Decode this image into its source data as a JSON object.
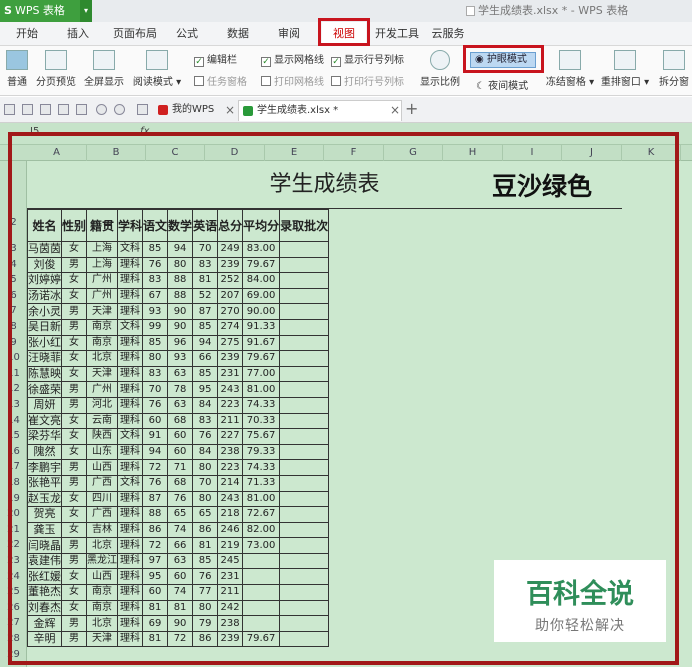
{
  "app": {
    "menu_button": "WPS 表格",
    "window_title": "学生成绩表.xlsx * - WPS 表格"
  },
  "tabs": [
    "开始",
    "插入",
    "页面布局",
    "公式",
    "数据",
    "审阅",
    "视图",
    "开发工具",
    "云服务"
  ],
  "ribbon": {
    "normal": "普通",
    "page_preview": "分页预览",
    "fullscreen": "全屏显示",
    "reading_mode": "阅读模式",
    "edit_bar": "编辑栏",
    "task_pane": "任务窗格",
    "show_gridlines": "显示网格线",
    "print_gridlines": "打印网格线",
    "show_row_col": "显示行号列标",
    "print_row_col": "打印行号列标",
    "zoom": "显示比例",
    "eye_mode": "护眼模式",
    "night_mode": "夜间模式",
    "freeze": "冻结窗格",
    "rearrange": "重排窗口",
    "split": "拆分窗"
  },
  "doc_tabs": {
    "my_wps": "我的WPS",
    "file": "学生成绩表.xlsx *"
  },
  "formula_bar": {
    "name_box": "J5",
    "fx": "fx"
  },
  "columns": [
    "A",
    "B",
    "C",
    "D",
    "E",
    "F",
    "G",
    "H",
    "I",
    "J",
    "K"
  ],
  "row_numbers": [
    "2",
    "3",
    "4",
    "5",
    "6",
    "7",
    "8",
    "9",
    "10",
    "11",
    "12",
    "13",
    "14",
    "15",
    "16",
    "17",
    "18",
    "19",
    "20",
    "21",
    "22",
    "23",
    "24",
    "25",
    "26",
    "27",
    "28",
    "29"
  ],
  "sheet": {
    "title": "学生成绩表",
    "overlay_label": "豆沙绿色",
    "headers": [
      "姓名",
      "性别",
      "籍贯",
      "学科",
      "语文",
      "数学",
      "英语",
      "总分",
      "平均分",
      "录取批次"
    ],
    "rows": [
      [
        "马茵茵",
        "女",
        "上海",
        "文科",
        "85",
        "94",
        "70",
        "249",
        "83.00",
        ""
      ],
      [
        "刘俊",
        "男",
        "上海",
        "理科",
        "76",
        "80",
        "83",
        "239",
        "79.67",
        ""
      ],
      [
        "刘婷婷",
        "女",
        "广州",
        "理科",
        "83",
        "88",
        "81",
        "252",
        "84.00",
        ""
      ],
      [
        "汤诺冰",
        "女",
        "广州",
        "理科",
        "67",
        "88",
        "52",
        "207",
        "69.00",
        ""
      ],
      [
        "余小灵",
        "男",
        "天津",
        "理科",
        "93",
        "90",
        "87",
        "270",
        "90.00",
        ""
      ],
      [
        "吴日新",
        "男",
        "南京",
        "文科",
        "99",
        "90",
        "85",
        "274",
        "91.33",
        ""
      ],
      [
        "张小红",
        "女",
        "南京",
        "理科",
        "85",
        "96",
        "94",
        "275",
        "91.67",
        ""
      ],
      [
        "汪晓菲",
        "女",
        "北京",
        "理科",
        "80",
        "93",
        "66",
        "239",
        "79.67",
        ""
      ],
      [
        "陈慧映",
        "女",
        "天津",
        "理科",
        "83",
        "63",
        "85",
        "231",
        "77.00",
        ""
      ],
      [
        "徐盛荣",
        "男",
        "广州",
        "理科",
        "70",
        "78",
        "95",
        "243",
        "81.00",
        ""
      ],
      [
        "周妍",
        "男",
        "河北",
        "理科",
        "76",
        "63",
        "84",
        "223",
        "74.33",
        ""
      ],
      [
        "崔文亮",
        "女",
        "云南",
        "理科",
        "60",
        "68",
        "83",
        "211",
        "70.33",
        ""
      ],
      [
        "梁芬华",
        "女",
        "陕西",
        "文科",
        "91",
        "60",
        "76",
        "227",
        "75.67",
        ""
      ],
      [
        "隗然",
        "女",
        "山东",
        "理科",
        "94",
        "60",
        "84",
        "238",
        "79.33",
        ""
      ],
      [
        "李鹏宇",
        "男",
        "山西",
        "理科",
        "72",
        "71",
        "80",
        "223",
        "74.33",
        ""
      ],
      [
        "张艳平",
        "男",
        "广西",
        "文科",
        "76",
        "68",
        "70",
        "214",
        "71.33",
        ""
      ],
      [
        "赵玉龙",
        "女",
        "四川",
        "理科",
        "87",
        "76",
        "80",
        "243",
        "81.00",
        ""
      ],
      [
        "贺亮",
        "女",
        "广西",
        "理科",
        "88",
        "65",
        "65",
        "218",
        "72.67",
        ""
      ],
      [
        "龚玉",
        "女",
        "吉林",
        "理科",
        "86",
        "74",
        "86",
        "246",
        "82.00",
        ""
      ],
      [
        "闫晓晶",
        "男",
        "北京",
        "理科",
        "72",
        "66",
        "81",
        "219",
        "73.00",
        ""
      ],
      [
        "袁建伟",
        "男",
        "黑龙江",
        "理科",
        "97",
        "63",
        "85",
        "245",
        "",
        ""
      ],
      [
        "张红媛",
        "女",
        "山西",
        "理科",
        "95",
        "60",
        "76",
        "231",
        "",
        ""
      ],
      [
        "董艳杰",
        "女",
        "南京",
        "理科",
        "60",
        "74",
        "77",
        "211",
        "",
        ""
      ],
      [
        "刘春杰",
        "女",
        "南京",
        "理科",
        "81",
        "81",
        "80",
        "242",
        "",
        ""
      ],
      [
        "金辉",
        "男",
        "北京",
        "理科",
        "69",
        "90",
        "79",
        "238",
        "",
        ""
      ],
      [
        "辛明",
        "男",
        "天津",
        "理科",
        "81",
        "72",
        "86",
        "239",
        "79.67",
        ""
      ]
    ]
  },
  "watermark": {
    "title": "百科全说",
    "subtitle": "助你轻松解决"
  },
  "colors": {
    "sheet_bg": "#cce8cf",
    "highlight_red": "#c8141e",
    "brand_green": "#3e9f3e"
  }
}
